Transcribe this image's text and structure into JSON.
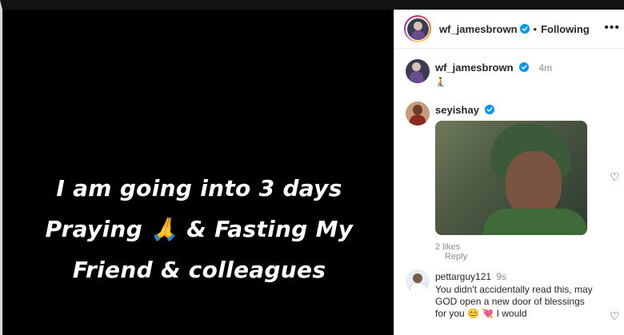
{
  "post": {
    "text_lines": [
      "I am going into 3 days",
      "Praying 🙏 & Fasting My",
      "Friend & colleagues"
    ]
  },
  "header": {
    "username": "wf_jamesbrown",
    "dot": "•",
    "following": "Following",
    "more_icon": "more-icon"
  },
  "comments": [
    {
      "username": "wf_jamesbrown",
      "time": "4m",
      "text": "🧎"
    },
    {
      "username": "seyishay",
      "likes": "2 likes",
      "reply": "Reply"
    },
    {
      "username": "pettarguy121",
      "time": "9s",
      "text": "You didn't accidentally read this, may GOD open a new door of blessings for you 😊 💘 I would"
    }
  ],
  "colors": {
    "verified_blue": "#0095f6",
    "media_background": "#000000"
  }
}
